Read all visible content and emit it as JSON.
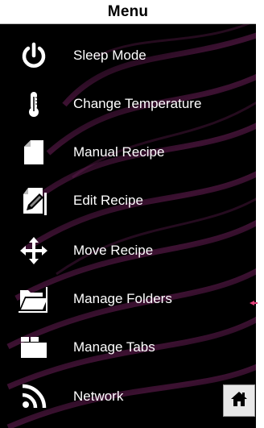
{
  "header": {
    "title": "Menu"
  },
  "items": [
    {
      "label": "Sleep Mode",
      "icon": "power-icon"
    },
    {
      "label": "Change Temperature",
      "icon": "thermometer-icon"
    },
    {
      "label": "Manual Recipe",
      "icon": "document-icon"
    },
    {
      "label": "Edit Recipe",
      "icon": "edit-document-icon"
    },
    {
      "label": "Move Recipe",
      "icon": "move-arrows-icon"
    },
    {
      "label": "Manage Folders",
      "icon": "open-folder-icon"
    },
    {
      "label": "Manage Tabs",
      "icon": "tabs-folder-icon"
    },
    {
      "label": "Network",
      "icon": "wifi-signal-icon"
    }
  ],
  "home_button": {
    "icon": "home-icon"
  },
  "colors": {
    "background": "#000000",
    "accent_purple": "#5a1a4a",
    "text": "#ffffff",
    "header_bg": "#ffffff"
  }
}
